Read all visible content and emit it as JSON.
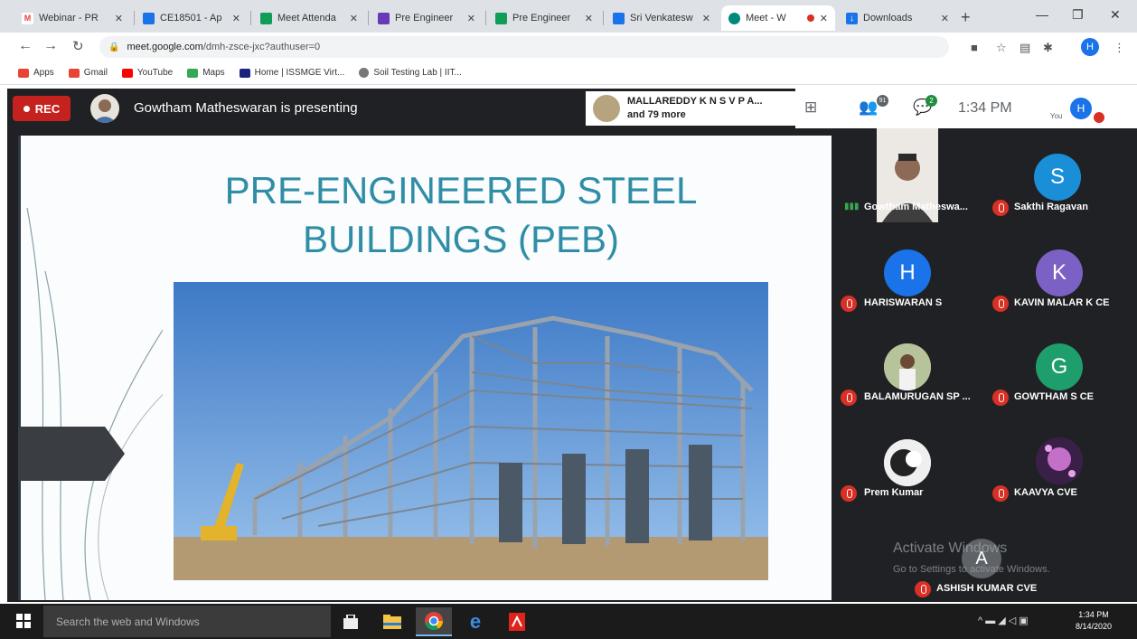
{
  "browser": {
    "tabs": [
      {
        "title": "Webinar - PR",
        "favicon": "gmail-icon",
        "color": "#ffffff"
      },
      {
        "title": "CE18501 - Ap",
        "favicon": "app-icon",
        "color": "#1a73e8"
      },
      {
        "title": "Meet Attenda",
        "favicon": "sheets-icon",
        "color": "#0f9d58"
      },
      {
        "title": "Pre Engineer",
        "favicon": "forms-icon",
        "color": "#673ab7"
      },
      {
        "title": "Pre Engineer",
        "favicon": "sheets-icon",
        "color": "#0f9d58"
      },
      {
        "title": "Sri Venkatesw",
        "favicon": "app-icon",
        "color": "#1a73e8"
      },
      {
        "title": "Meet - W",
        "favicon": "meet-icon",
        "color": "#00897b",
        "active": true
      },
      {
        "title": "Downloads",
        "favicon": "download-icon",
        "color": "#1a73e8"
      }
    ],
    "url_host": "meet.google.com",
    "url_path": "/dmh-zsce-jxc?authuser=0",
    "profile_initial": "H",
    "bookmarks": [
      {
        "label": "Apps",
        "color": "#ea4335"
      },
      {
        "label": "Gmail",
        "color": "#ea4335"
      },
      {
        "label": "YouTube",
        "color": "#ff0000"
      },
      {
        "label": "Maps",
        "color": "#34a853"
      },
      {
        "label": "Home | ISSMGE Virt...",
        "color": "#1a237e"
      },
      {
        "label": "Soil Testing Lab | IIT...",
        "color": "#777777"
      }
    ]
  },
  "meet": {
    "rec_label": "REC",
    "presenting_text": "Gowtham Matheswaran is presenting",
    "others_line1": "MALLAREDDY K N S V P A...",
    "others_line2": "and 79 more",
    "participant_count": "91",
    "chat_badge": "2",
    "time": "1:34 PM",
    "you_label": "You",
    "self_initial": "H"
  },
  "slide": {
    "title_line1": "PRE-ENGINEERED STEEL",
    "title_line2": "BUILDINGS (PEB)"
  },
  "participants": [
    {
      "name": "Gowtham Matheswa...",
      "initial": "",
      "color": "#3c4043",
      "speaking": true
    },
    {
      "name": "Sakthi Ragavan",
      "initial": "S",
      "color": "#1a8fd8"
    },
    {
      "name": "HARISWARAN S",
      "initial": "H",
      "color": "#1a73e8"
    },
    {
      "name": "KAVIN MALAR K CE",
      "initial": "K",
      "color": "#7b61c4"
    },
    {
      "name": "BALAMURUGAN SP ...",
      "initial": "",
      "color": "#c9b68c"
    },
    {
      "name": "GOWTHAM S CE",
      "initial": "G",
      "color": "#1e9e6a"
    },
    {
      "name": "Prem Kumar",
      "initial": "",
      "color": "#dddddd"
    },
    {
      "name": "KAAVYA CVE",
      "initial": "",
      "color": "#4a2a5c"
    },
    {
      "name": "ASHISH KUMAR CVE",
      "initial": "A",
      "color": "#5f6368"
    }
  ],
  "windows": {
    "watermark_title": "Activate Windows",
    "watermark_sub": "Go to Settings to activate Windows.",
    "search_placeholder": "Search the web and Windows",
    "clock_time": "1:34 PM",
    "clock_date": "8/14/2020"
  }
}
